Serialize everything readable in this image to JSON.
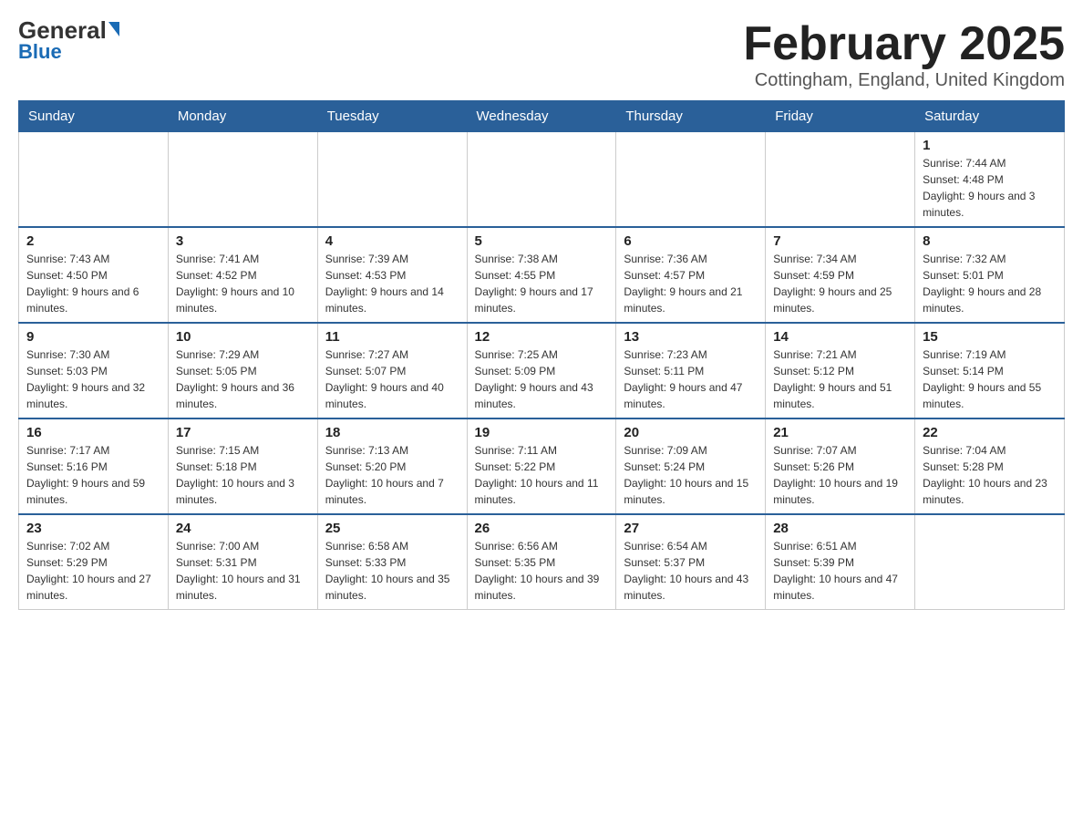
{
  "header": {
    "logo_general": "General",
    "logo_blue": "Blue",
    "month_title": "February 2025",
    "location": "Cottingham, England, United Kingdom"
  },
  "days_of_week": [
    "Sunday",
    "Monday",
    "Tuesday",
    "Wednesday",
    "Thursday",
    "Friday",
    "Saturday"
  ],
  "weeks": [
    {
      "days": [
        {
          "number": "",
          "info": ""
        },
        {
          "number": "",
          "info": ""
        },
        {
          "number": "",
          "info": ""
        },
        {
          "number": "",
          "info": ""
        },
        {
          "number": "",
          "info": ""
        },
        {
          "number": "",
          "info": ""
        },
        {
          "number": "1",
          "info": "Sunrise: 7:44 AM\nSunset: 4:48 PM\nDaylight: 9 hours and 3 minutes."
        }
      ]
    },
    {
      "days": [
        {
          "number": "2",
          "info": "Sunrise: 7:43 AM\nSunset: 4:50 PM\nDaylight: 9 hours and 6 minutes."
        },
        {
          "number": "3",
          "info": "Sunrise: 7:41 AM\nSunset: 4:52 PM\nDaylight: 9 hours and 10 minutes."
        },
        {
          "number": "4",
          "info": "Sunrise: 7:39 AM\nSunset: 4:53 PM\nDaylight: 9 hours and 14 minutes."
        },
        {
          "number": "5",
          "info": "Sunrise: 7:38 AM\nSunset: 4:55 PM\nDaylight: 9 hours and 17 minutes."
        },
        {
          "number": "6",
          "info": "Sunrise: 7:36 AM\nSunset: 4:57 PM\nDaylight: 9 hours and 21 minutes."
        },
        {
          "number": "7",
          "info": "Sunrise: 7:34 AM\nSunset: 4:59 PM\nDaylight: 9 hours and 25 minutes."
        },
        {
          "number": "8",
          "info": "Sunrise: 7:32 AM\nSunset: 5:01 PM\nDaylight: 9 hours and 28 minutes."
        }
      ]
    },
    {
      "days": [
        {
          "number": "9",
          "info": "Sunrise: 7:30 AM\nSunset: 5:03 PM\nDaylight: 9 hours and 32 minutes."
        },
        {
          "number": "10",
          "info": "Sunrise: 7:29 AM\nSunset: 5:05 PM\nDaylight: 9 hours and 36 minutes."
        },
        {
          "number": "11",
          "info": "Sunrise: 7:27 AM\nSunset: 5:07 PM\nDaylight: 9 hours and 40 minutes."
        },
        {
          "number": "12",
          "info": "Sunrise: 7:25 AM\nSunset: 5:09 PM\nDaylight: 9 hours and 43 minutes."
        },
        {
          "number": "13",
          "info": "Sunrise: 7:23 AM\nSunset: 5:11 PM\nDaylight: 9 hours and 47 minutes."
        },
        {
          "number": "14",
          "info": "Sunrise: 7:21 AM\nSunset: 5:12 PM\nDaylight: 9 hours and 51 minutes."
        },
        {
          "number": "15",
          "info": "Sunrise: 7:19 AM\nSunset: 5:14 PM\nDaylight: 9 hours and 55 minutes."
        }
      ]
    },
    {
      "days": [
        {
          "number": "16",
          "info": "Sunrise: 7:17 AM\nSunset: 5:16 PM\nDaylight: 9 hours and 59 minutes."
        },
        {
          "number": "17",
          "info": "Sunrise: 7:15 AM\nSunset: 5:18 PM\nDaylight: 10 hours and 3 minutes."
        },
        {
          "number": "18",
          "info": "Sunrise: 7:13 AM\nSunset: 5:20 PM\nDaylight: 10 hours and 7 minutes."
        },
        {
          "number": "19",
          "info": "Sunrise: 7:11 AM\nSunset: 5:22 PM\nDaylight: 10 hours and 11 minutes."
        },
        {
          "number": "20",
          "info": "Sunrise: 7:09 AM\nSunset: 5:24 PM\nDaylight: 10 hours and 15 minutes."
        },
        {
          "number": "21",
          "info": "Sunrise: 7:07 AM\nSunset: 5:26 PM\nDaylight: 10 hours and 19 minutes."
        },
        {
          "number": "22",
          "info": "Sunrise: 7:04 AM\nSunset: 5:28 PM\nDaylight: 10 hours and 23 minutes."
        }
      ]
    },
    {
      "days": [
        {
          "number": "23",
          "info": "Sunrise: 7:02 AM\nSunset: 5:29 PM\nDaylight: 10 hours and 27 minutes."
        },
        {
          "number": "24",
          "info": "Sunrise: 7:00 AM\nSunset: 5:31 PM\nDaylight: 10 hours and 31 minutes."
        },
        {
          "number": "25",
          "info": "Sunrise: 6:58 AM\nSunset: 5:33 PM\nDaylight: 10 hours and 35 minutes."
        },
        {
          "number": "26",
          "info": "Sunrise: 6:56 AM\nSunset: 5:35 PM\nDaylight: 10 hours and 39 minutes."
        },
        {
          "number": "27",
          "info": "Sunrise: 6:54 AM\nSunset: 5:37 PM\nDaylight: 10 hours and 43 minutes."
        },
        {
          "number": "28",
          "info": "Sunrise: 6:51 AM\nSunset: 5:39 PM\nDaylight: 10 hours and 47 minutes."
        },
        {
          "number": "",
          "info": ""
        }
      ]
    }
  ]
}
